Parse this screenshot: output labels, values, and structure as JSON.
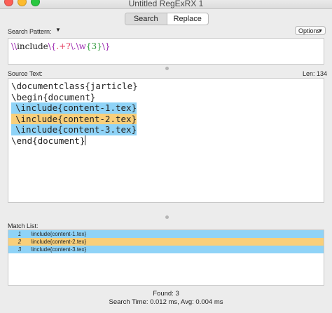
{
  "window": {
    "title": "Untitled RegExRX 1"
  },
  "tabs": [
    {
      "label": "Search"
    },
    {
      "label": "Replace"
    }
  ],
  "search": {
    "label": "Search Pattern:",
    "options_label": "Options",
    "pattern_parts": [
      {
        "text": "\\\\",
        "color": "#9b27b0"
      },
      {
        "text": "include",
        "color": "#222222"
      },
      {
        "text": "\\{",
        "color": "#9b27b0"
      },
      {
        "text": ".+?",
        "color": "#e43e5f"
      },
      {
        "text": "\\.",
        "color": "#9b27b0"
      },
      {
        "text": "\\w",
        "color": "#9b27b0"
      },
      {
        "text": "{3}",
        "color": "#2f9a3b"
      },
      {
        "text": "\\}",
        "color": "#9b27b0"
      }
    ]
  },
  "source": {
    "label": "Source Text:",
    "len_label": "Len: 134",
    "lines": [
      {
        "text": "\\documentclass{jarticle}",
        "highlight": ""
      },
      {
        "text": "\\begin{document}",
        "highlight": ""
      },
      {
        "text": "\\include{content-1.tex}",
        "highlight": "#8fd3f7"
      },
      {
        "text": "\\include{content-2.tex}",
        "highlight": "#f9cf7a"
      },
      {
        "text": "\\include{content-3.tex}",
        "highlight": "#8fd3f7"
      },
      {
        "text": "\\end{document}",
        "highlight": ""
      }
    ]
  },
  "match_list": {
    "label": "Match List:",
    "rows": [
      {
        "num": "1",
        "text": "\\include{content-1.tex}",
        "color": "#8fd3f7"
      },
      {
        "num": "2",
        "text": "\\include{content-2.tex}",
        "color": "#f9cf7a"
      },
      {
        "num": "3",
        "text": "\\include{content-3.tex}",
        "color": "#8fd3f7"
      }
    ]
  },
  "footer": {
    "found": "Found: 3",
    "timing": "Search Time: 0.012 ms, Avg: 0.004 ms"
  },
  "colors": {
    "close": "#fc5f57",
    "minimize": "#fdbb2e",
    "zoom": "#29c840"
  }
}
